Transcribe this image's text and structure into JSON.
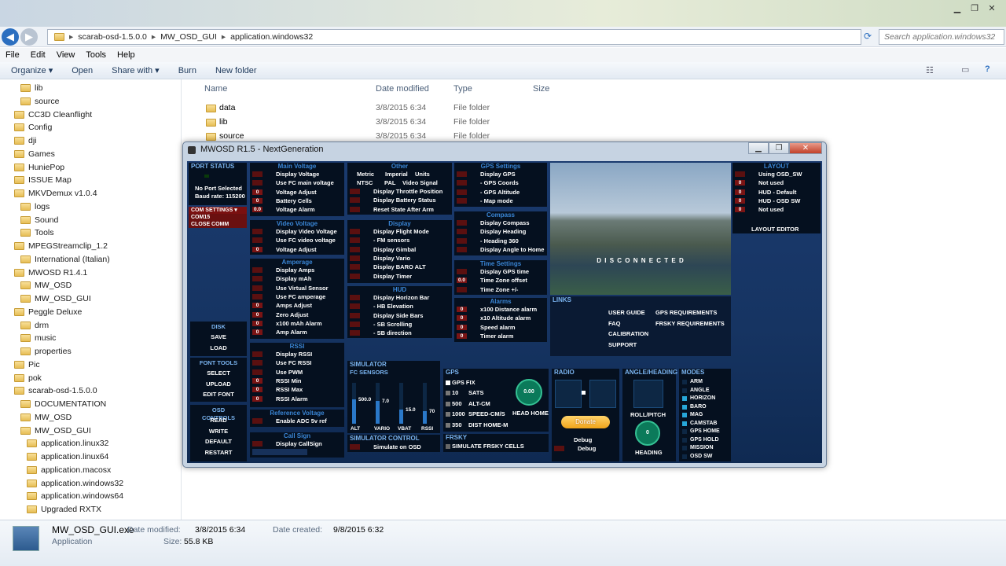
{
  "explorer": {
    "address": [
      "scarab-osd-1.5.0.0",
      "MW_OSD_GUI",
      "application.windows32"
    ],
    "search_placeholder": "Search application.windows32",
    "menu": [
      "File",
      "Edit",
      "View",
      "Tools",
      "Help"
    ],
    "toolbar": [
      "Organize ▾",
      "Open",
      "Share with ▾",
      "Burn",
      "New folder"
    ],
    "sidebar": [
      {
        "label": "lib",
        "indent": 2
      },
      {
        "label": "source",
        "indent": 2
      },
      {
        "label": "CC3D Cleanflight",
        "indent": 1
      },
      {
        "label": "Config",
        "indent": 1
      },
      {
        "label": "dji",
        "indent": 1
      },
      {
        "label": "Games",
        "indent": 1
      },
      {
        "label": "HuniePop",
        "indent": 1
      },
      {
        "label": "ISSUE Map",
        "indent": 1
      },
      {
        "label": "MKVDemux v1.0.4",
        "indent": 1
      },
      {
        "label": "logs",
        "indent": 2
      },
      {
        "label": "Sound",
        "indent": 2
      },
      {
        "label": "Tools",
        "indent": 2
      },
      {
        "label": "MPEGStreamclip_1.2",
        "indent": 1
      },
      {
        "label": "International (Italian)",
        "indent": 2
      },
      {
        "label": "MWOSD R1.4.1",
        "indent": 1
      },
      {
        "label": "MW_OSD",
        "indent": 2
      },
      {
        "label": "MW_OSD_GUI",
        "indent": 2
      },
      {
        "label": "Peggle Deluxe",
        "indent": 1
      },
      {
        "label": "drm",
        "indent": 2
      },
      {
        "label": "music",
        "indent": 2
      },
      {
        "label": "properties",
        "indent": 2
      },
      {
        "label": "Pic",
        "indent": 1
      },
      {
        "label": "pok",
        "indent": 1
      },
      {
        "label": "scarab-osd-1.5.0.0",
        "indent": 1
      },
      {
        "label": "DOCUMENTATION",
        "indent": 2
      },
      {
        "label": "MW_OSD",
        "indent": 2
      },
      {
        "label": "MW_OSD_GUI",
        "indent": 2
      },
      {
        "label": "application.linux32",
        "indent": 3
      },
      {
        "label": "application.linux64",
        "indent": 3
      },
      {
        "label": "application.macosx",
        "indent": 3
      },
      {
        "label": "application.windows32",
        "indent": 3
      },
      {
        "label": "application.windows64",
        "indent": 3
      },
      {
        "label": "Upgraded RXTX",
        "indent": 3
      }
    ],
    "columns": [
      "Name",
      "Date modified",
      "Type",
      "Size"
    ],
    "files": [
      {
        "name": "data",
        "date": "3/8/2015 6:34",
        "type": "File folder"
      },
      {
        "name": "lib",
        "date": "3/8/2015 6:34",
        "type": "File folder"
      },
      {
        "name": "source",
        "date": "3/8/2015 6:34",
        "type": "File folder"
      }
    ],
    "details": {
      "name": "MW_OSD_GUI.exe",
      "kind": "Application",
      "modified_label": "Date modified:",
      "modified": "3/8/2015 6:34",
      "created_label": "Date created:",
      "created": "9/8/2015 6:32",
      "size_label": "Size:",
      "size": "55.8 KB"
    }
  },
  "mwosd": {
    "title": "MWOSD R1.5 - NextGeneration",
    "port": {
      "header": "PORT STATUS",
      "no_port": "No Port Selected",
      "baud": "Baud rate: 115200",
      "com_settings": "COM SETTINGS",
      "com": "COM15",
      "close": "CLOSE COMM"
    },
    "disk": {
      "header": "DISK",
      "save": "SAVE",
      "load": "LOAD"
    },
    "font": {
      "header": "FONT TOOLS",
      "select": "SELECT",
      "upload": "UPLOAD",
      "edit": "EDIT FONT"
    },
    "osdc": {
      "header": "OSD CONTROLS",
      "read": "READ",
      "write": "WRITE",
      "default": "DEFAULT",
      "restart": "RESTART"
    },
    "main_voltage": {
      "header": "Main Voltage",
      "items": [
        {
          "l": "Display Voltage"
        },
        {
          "l": "Use FC main voltage"
        },
        {
          "l": "Voltage Adjust",
          "v": "0"
        },
        {
          "l": "Battery Cells",
          "v": "0"
        },
        {
          "l": "Voltage Alarm",
          "v": "0.0"
        }
      ]
    },
    "video_voltage": {
      "header": "Video Voltage",
      "items": [
        {
          "l": "Display Video Voltage"
        },
        {
          "l": "Use FC video voltage"
        },
        {
          "l": "Voltage Adjust",
          "v": "0"
        }
      ]
    },
    "amperage": {
      "header": "Amperage",
      "items": [
        {
          "l": "Display Amps"
        },
        {
          "l": "Display mAh"
        },
        {
          "l": "Use Virtual Sensor"
        },
        {
          "l": "Use FC amperage"
        },
        {
          "l": "Amps Adjust",
          "v": "0"
        },
        {
          "l": "Zero Adjust",
          "v": "0"
        },
        {
          "l": "x100 mAh Alarm",
          "v": "0"
        },
        {
          "l": "Amp Alarm",
          "v": "0"
        }
      ]
    },
    "rssi": {
      "header": "RSSI",
      "items": [
        {
          "l": "Display RSSI"
        },
        {
          "l": "Use FC RSSI"
        },
        {
          "l": "Use PWM"
        },
        {
          "l": "RSSI Min",
          "v": "0"
        },
        {
          "l": "RSSI Max",
          "v": "0"
        },
        {
          "l": "RSSI Alarm",
          "v": "0"
        }
      ]
    },
    "refv": {
      "header": "Reference Voltage",
      "items": [
        {
          "l": "Enable ADC 5v ref"
        }
      ]
    },
    "callsign": {
      "header": "Call Sign",
      "items": [
        {
          "l": "Display CallSign"
        }
      ]
    },
    "other": {
      "header": "Other",
      "items": [
        {
          "l": "Display Throttle Position"
        },
        {
          "l": "Display Battery Status"
        },
        {
          "l": "Reset State After Arm"
        }
      ],
      "units": [
        "Metric",
        "Imperial",
        "Units"
      ],
      "signal": [
        "NTSC",
        "PAL",
        "Video Signal"
      ]
    },
    "display": {
      "header": "Display",
      "items": [
        {
          "l": "Display Flight Mode"
        },
        {
          "l": " - FM sensors"
        },
        {
          "l": "Display Gimbal"
        },
        {
          "l": "Display Vario"
        },
        {
          "l": "Display BARO ALT"
        },
        {
          "l": "Display Timer"
        }
      ]
    },
    "hud": {
      "header": "HUD",
      "items": [
        {
          "l": "Display Horizon Bar"
        },
        {
          "l": " - HB Elevation"
        },
        {
          "l": "Display Side Bars"
        },
        {
          "l": " - SB Scrolling"
        },
        {
          "l": " - SB direction"
        }
      ]
    },
    "gps_settings": {
      "header": "GPS Settings",
      "items": [
        {
          "l": "Display GPS"
        },
        {
          "l": " - GPS Coords"
        },
        {
          "l": " - GPS Altitude"
        },
        {
          "l": " - Map mode"
        }
      ]
    },
    "compass": {
      "header": "Compass",
      "items": [
        {
          "l": "Display Compass"
        },
        {
          "l": "Display Heading"
        },
        {
          "l": " - Heading 360"
        },
        {
          "l": "Display Angle to Home"
        }
      ]
    },
    "time": {
      "header": "Time Settings",
      "items": [
        {
          "l": "Display GPS time"
        },
        {
          "l": "Time Zone offset",
          "v": "0.0"
        },
        {
          "l": "Time Zone +/-"
        }
      ]
    },
    "alarms": {
      "header": "Alarms",
      "items": [
        {
          "l": "x100 Distance alarm",
          "v": "0"
        },
        {
          "l": "x10  Altitude alarm",
          "v": "0"
        },
        {
          "l": "Speed alarm",
          "v": "0"
        },
        {
          "l": "Timer alarm",
          "v": "0"
        }
      ]
    },
    "preview": {
      "text": "D I S C O N N E C T E D"
    },
    "layout": {
      "header": "LAYOUT",
      "items": [
        {
          "l": "Using OSD_SW"
        },
        {
          "l": "Not used",
          "v": "0"
        },
        {
          "l": "HUD - Default",
          "v": "0"
        },
        {
          "l": "HUD - OSD SW",
          "v": "0"
        },
        {
          "l": "Not used",
          "v": "0"
        }
      ],
      "editor": "LAYOUT EDITOR"
    },
    "links": {
      "header": "LINKS",
      "left": [
        "USER GUIDE",
        "FAQ",
        "CALIBRATION",
        "SUPPORT"
      ],
      "right": [
        "GPS REQUIREMENTS",
        "FRSKY REQUIREMENTS"
      ]
    },
    "simulator": {
      "header": "SIMULATOR",
      "fc_sensors": "FC SENSORS",
      "bars": [
        {
          "l": "ALT",
          "v": "500.0",
          "frac": 0.6
        },
        {
          "l": "VARIO",
          "v": "7.0",
          "frac": 0.55
        },
        {
          "l": "VBAT",
          "v": "15.0",
          "frac": 0.35
        },
        {
          "l": "RSSI",
          "v": "70",
          "frac": 0.3
        }
      ],
      "control_header": "SIMULATOR CONTROL",
      "control": "Simulate on OSD"
    },
    "gps": {
      "header": "GPS",
      "fix": "GPS FIX",
      "rows": [
        {
          "v": "10",
          "l": "SATS"
        },
        {
          "v": "500",
          "l": "ALT-CM"
        },
        {
          "v": "1000",
          "l": "SPEED-CM/S"
        },
        {
          "v": "350",
          "l": "DIST HOME-M"
        }
      ],
      "dial": "0.00",
      "head": "HEAD HOME"
    },
    "frsky": {
      "header": "FRSKY",
      "label": "SIMULATE FRSKY CELLS"
    },
    "radio": {
      "header": "RADIO",
      "donate": "Donate",
      "debug": "Debug"
    },
    "angle": {
      "header": "ANGLE/HEADING",
      "roll": "ROLL/PITCH",
      "heading_val": "0",
      "heading": "HEADING"
    },
    "modes": {
      "header": "MODES",
      "items": [
        {
          "l": "ARM",
          "on": false
        },
        {
          "l": "ANGLE",
          "on": false
        },
        {
          "l": "HORIZON",
          "on": true
        },
        {
          "l": "BARO",
          "on": true
        },
        {
          "l": "MAG",
          "on": true
        },
        {
          "l": "CAMSTAB",
          "on": true
        },
        {
          "l": "GPS HOME",
          "on": false
        },
        {
          "l": "GPS HOLD",
          "on": false
        },
        {
          "l": "MISSION",
          "on": false
        },
        {
          "l": "OSD SW",
          "on": false
        }
      ]
    },
    "colors": {
      "accent": "#3a86d6",
      "toggle": "#5a1010",
      "panel": "#05101f"
    }
  }
}
